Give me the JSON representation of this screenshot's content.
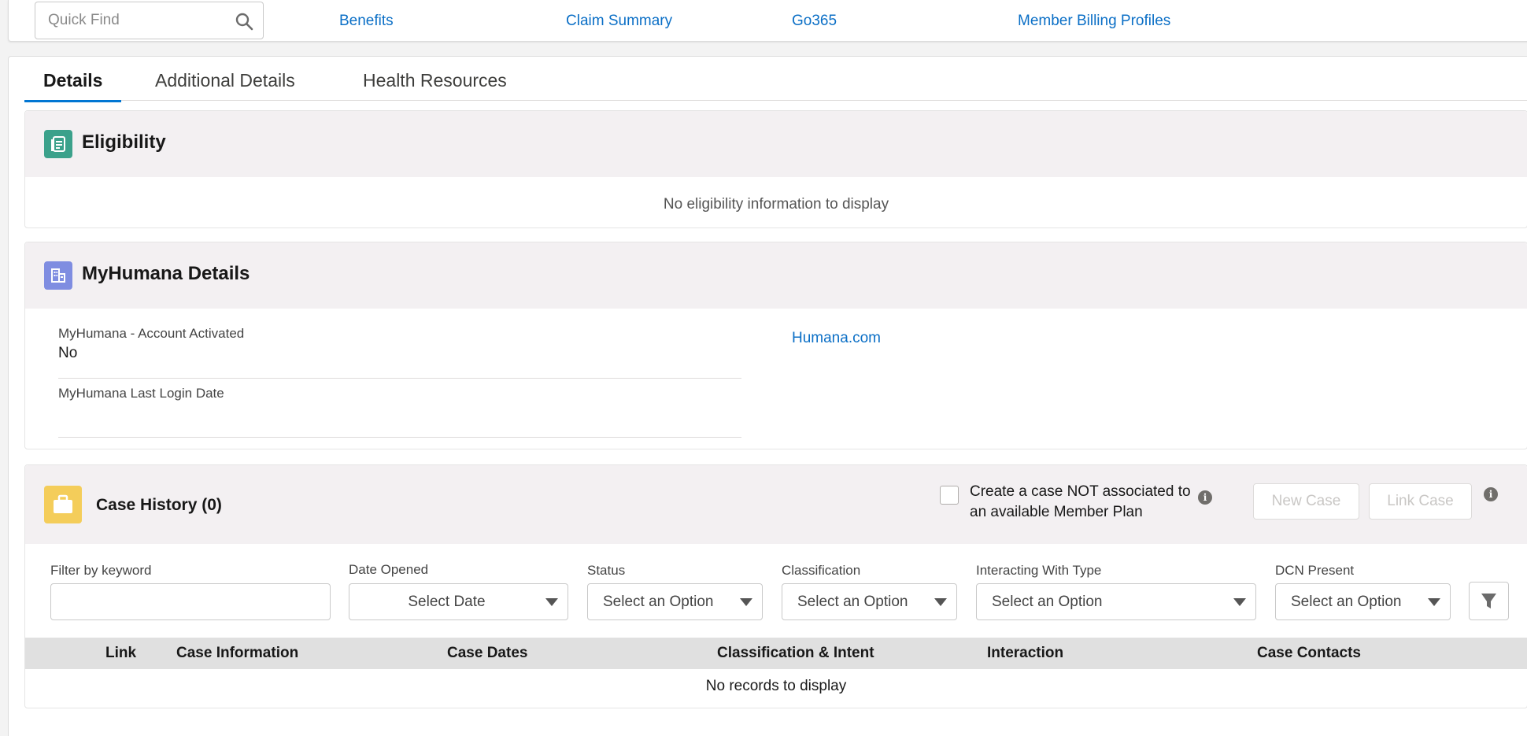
{
  "topbar": {
    "search_placeholder": "Quick Find",
    "links": [
      "Benefits",
      "Claim Summary",
      "Go365",
      "Member Billing Profiles"
    ]
  },
  "tabs": [
    "Details",
    "Additional Details",
    "Health Resources"
  ],
  "active_tab": "Details",
  "eligibility": {
    "title": "Eligibility",
    "empty_message": "No eligibility information to display",
    "icon_color": "#3ba18b"
  },
  "myhumana": {
    "title": "MyHumana Details",
    "icon_color": "#7f8de1",
    "account_activated_label": "MyHumana - Account Activated",
    "account_activated_value": "No",
    "last_login_label": "MyHumana Last Login Date",
    "last_login_value": "",
    "link": "Humana.com"
  },
  "case_history": {
    "title": "Case History (0)",
    "icon_color": "#f4cd5a",
    "checkbox_label_line1": "Create a case NOT associated to",
    "checkbox_label_line2": "an available Member Plan",
    "new_case_label": "New Case",
    "link_case_label": "Link Case",
    "filters": {
      "keyword_label": "Filter by keyword",
      "keyword_value": "",
      "date_label": "Date Opened",
      "date_value": "Select Date",
      "status_label": "Status",
      "status_value": "Select an Option",
      "classification_label": "Classification",
      "classification_value": "Select an Option",
      "interacting_label": "Interacting With Type",
      "interacting_value": "Select an Option",
      "dcn_label": "DCN Present",
      "dcn_value": "Select an Option"
    },
    "columns": [
      "Link",
      "Case Information",
      "Case Dates",
      "Classification & Intent",
      "Interaction",
      "Case Contacts"
    ],
    "empty_message": "No records to display"
  }
}
